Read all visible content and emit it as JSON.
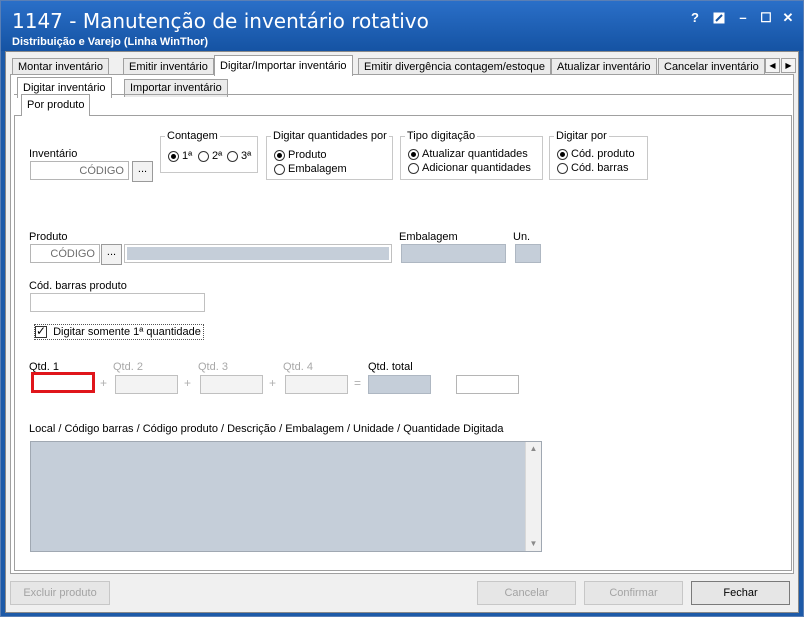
{
  "window": {
    "title": "1147 - Manutenção de inventário rotativo",
    "subtitle": "Distribuição e Varejo (Linha WinThor)",
    "help_glyph": "?",
    "min_glyph": "–",
    "max_glyph": "☐",
    "close_glyph": "✕"
  },
  "main_tabs": [
    {
      "label": "Montar inventário"
    },
    {
      "label": "Emitir inventário"
    },
    {
      "label": "Digitar/Importar inventário"
    },
    {
      "label": "Emitir divergência contagem/estoque"
    },
    {
      "label": "Atualizar inventário"
    },
    {
      "label": "Cancelar inventário"
    }
  ],
  "sub_tabs": [
    {
      "label": "Digitar inventário"
    },
    {
      "label": "Importar inventário"
    }
  ],
  "inner_tab": {
    "label": "Por produto"
  },
  "inventario": {
    "label": "Inventário",
    "value": "CÓDIGO",
    "button": "..."
  },
  "contagem": {
    "title": "Contagem",
    "options": [
      {
        "label": "1ª",
        "selected": true
      },
      {
        "label": "2ª",
        "selected": false
      },
      {
        "label": "3ª",
        "selected": false
      }
    ]
  },
  "digitar_qtd": {
    "title": "Digitar quantidades por",
    "options": [
      {
        "label": "Produto",
        "selected": true
      },
      {
        "label": "Embalagem",
        "selected": false
      }
    ]
  },
  "tipo_digitacao": {
    "title": "Tipo digitação",
    "options": [
      {
        "label": "Atualizar quantidades",
        "selected": true
      },
      {
        "label": "Adicionar quantidades",
        "selected": false
      }
    ]
  },
  "digitar_por": {
    "title": "Digitar por",
    "options": [
      {
        "label": "Cód. produto",
        "selected": true
      },
      {
        "label": "Cód. barras",
        "selected": false
      }
    ]
  },
  "produto": {
    "label": "Produto",
    "value": "CÓDIGO",
    "button": "...",
    "description": ""
  },
  "embalagem": {
    "label": "Embalagem",
    "value": ""
  },
  "un": {
    "label": "Un.",
    "value": ""
  },
  "cod_barras": {
    "label": "Cód. barras produto",
    "value": ""
  },
  "somente_1a": {
    "label": "Digitar somente 1ª quantidade",
    "checked": true
  },
  "quantidades": {
    "qtd1": {
      "label": "Qtd. 1",
      "value": ""
    },
    "qtd2": {
      "label": "Qtd. 2",
      "value": ""
    },
    "qtd3": {
      "label": "Qtd. 3",
      "value": ""
    },
    "qtd4": {
      "label": "Qtd. 4",
      "value": ""
    },
    "total": {
      "label": "Qtd. total",
      "value": ""
    },
    "extra": {
      "value": ""
    },
    "plus": "+",
    "equals": "="
  },
  "lista": {
    "header": "Local / Código barras / Código produto / Descrição / Embalagem / Unidade / Quantidade Digitada"
  },
  "buttons": {
    "excluir": "Excluir produto",
    "cancelar": "Cancelar",
    "confirmar": "Confirmar",
    "fechar": "Fechar"
  },
  "colors": {
    "highlight": "#e0161b",
    "titlebar": "#1d5aa8",
    "field_blue": "#c5ced9"
  }
}
